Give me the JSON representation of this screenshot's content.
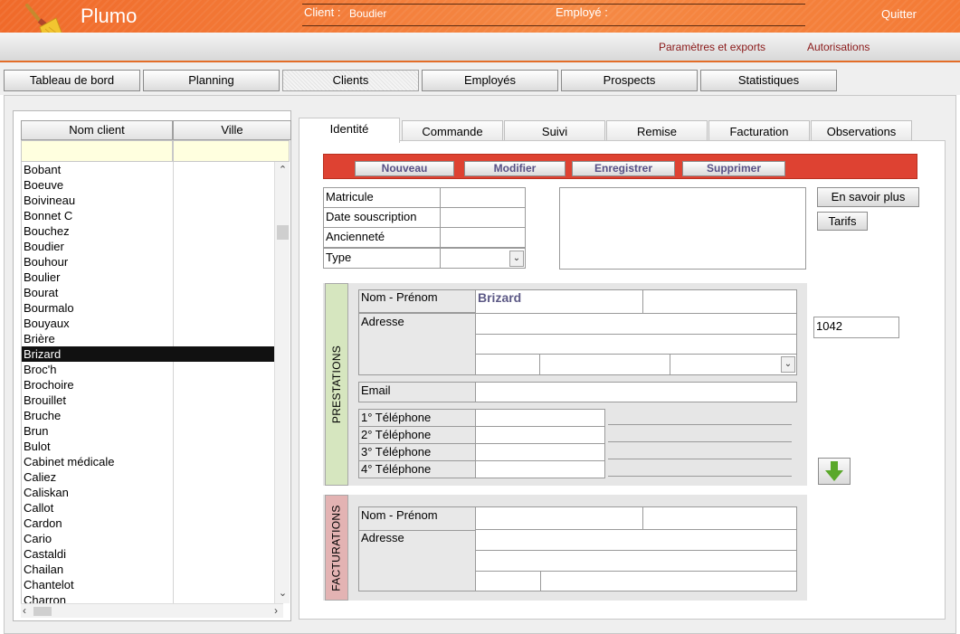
{
  "header": {
    "app_title": "Plumo",
    "client_label": "Client :",
    "client_value": "Boudier",
    "employee_label": "Employé :",
    "quit_label": "Quitter"
  },
  "subheader": {
    "settings_link": "Paramètres et exports",
    "auth_link": "Autorisations"
  },
  "main_tabs": [
    "Tableau de bord",
    "Planning",
    "Clients",
    "Employés",
    "Prospects",
    "Statistiques"
  ],
  "client_list": {
    "col_name": "Nom client",
    "col_city": "Ville",
    "rows": [
      "Bobant",
      "Boeuve",
      "Boivineau",
      "Bonnet C",
      "Bouchez",
      "Boudier",
      "Bouhour",
      "Boulier",
      "Bourat",
      "Bourmalo",
      "Bouyaux",
      "Brière",
      "Brizard",
      "Broc'h",
      "Brochoire",
      "Brouillet",
      "Bruche",
      "Brun",
      "Bulot",
      "Cabinet médicale",
      "Caliez",
      "Caliskan",
      "Callot",
      "Cardon",
      "Cario",
      "Castaldi",
      "Chailan",
      "Chantelot",
      "Charron"
    ],
    "selected": "Brizard"
  },
  "detail_tabs": [
    "Identité",
    "Commande",
    "Suivi",
    "Remise",
    "Facturation",
    "Observations"
  ],
  "actions": {
    "new": "Nouveau",
    "edit": "Modifier",
    "save": "Enregistrer",
    "delete": "Supprimer"
  },
  "identity": {
    "matricule": "Matricule",
    "date_souscription": "Date souscription",
    "anciennete": "Ancienneté",
    "type": "Type",
    "more_info": "En savoir plus",
    "tarifs": "Tarifs"
  },
  "prestations": {
    "section_label": "PRESTATIONS",
    "name_label": "Nom - Prénom",
    "name_value": "Brizard",
    "address_label": "Adresse",
    "email_label": "Email",
    "phone1": "1° Téléphone",
    "phone2": "2° Téléphone",
    "phone3": "3° Téléphone",
    "phone4": "4° Téléphone",
    "code_value": "1042"
  },
  "facturations": {
    "section_label": "FACTURATIONS",
    "name_label": "Nom - Prénom",
    "address_label": "Adresse"
  },
  "icons": {
    "logo": "broom-icon",
    "copy_down": "arrow-down-icon"
  },
  "colors": {
    "header_orange": "#f06a2a",
    "action_red": "#de4232",
    "prestations_green": "#d6e6bf",
    "facturations_pink": "#e3b3b3",
    "link_red": "#8b1a1a"
  }
}
